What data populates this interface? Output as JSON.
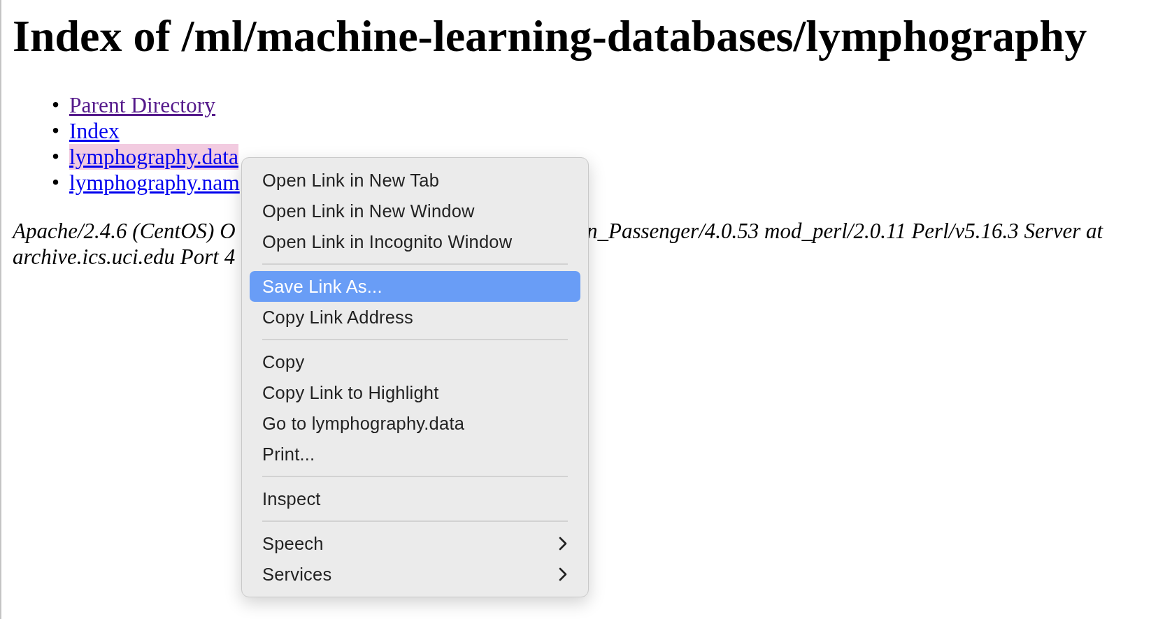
{
  "heading": "Index of /ml/machine-learning-databases/lymphography",
  "links": [
    {
      "bullet": "•",
      "text": "Parent Directory",
      "visited": true,
      "highlighted": false
    },
    {
      "bullet": "•",
      "text": "Index",
      "visited": false,
      "highlighted": false
    },
    {
      "bullet": "•",
      "text": "lymphography.data",
      "visited": false,
      "highlighted": true
    },
    {
      "bullet": "•",
      "text": "lymphography.nam",
      "visited": false,
      "highlighted": false
    }
  ],
  "address": {
    "line_1_left": "Apache/2.4.6 (CentOS) O",
    "line_1_right": "n_Passenger/4.0.53 mod_perl/2.0.11 Perl/v5.16.3 Server at",
    "line_2": "archive.ics.uci.edu Port 4"
  },
  "context_menu": {
    "groups": [
      [
        {
          "label": "Open Link in New Tab",
          "selected": false,
          "submenu": false
        },
        {
          "label": "Open Link in New Window",
          "selected": false,
          "submenu": false
        },
        {
          "label": "Open Link in Incognito Window",
          "selected": false,
          "submenu": false
        }
      ],
      [
        {
          "label": "Save Link As...",
          "selected": true,
          "submenu": false
        },
        {
          "label": "Copy Link Address",
          "selected": false,
          "submenu": false
        }
      ],
      [
        {
          "label": "Copy",
          "selected": false,
          "submenu": false
        },
        {
          "label": "Copy Link to Highlight",
          "selected": false,
          "submenu": false
        },
        {
          "label": "Go to lymphography.data",
          "selected": false,
          "submenu": false
        },
        {
          "label": "Print...",
          "selected": false,
          "submenu": false
        }
      ],
      [
        {
          "label": "Inspect",
          "selected": false,
          "submenu": false
        }
      ],
      [
        {
          "label": "Speech",
          "selected": false,
          "submenu": true
        },
        {
          "label": "Services",
          "selected": false,
          "submenu": true
        }
      ]
    ]
  }
}
